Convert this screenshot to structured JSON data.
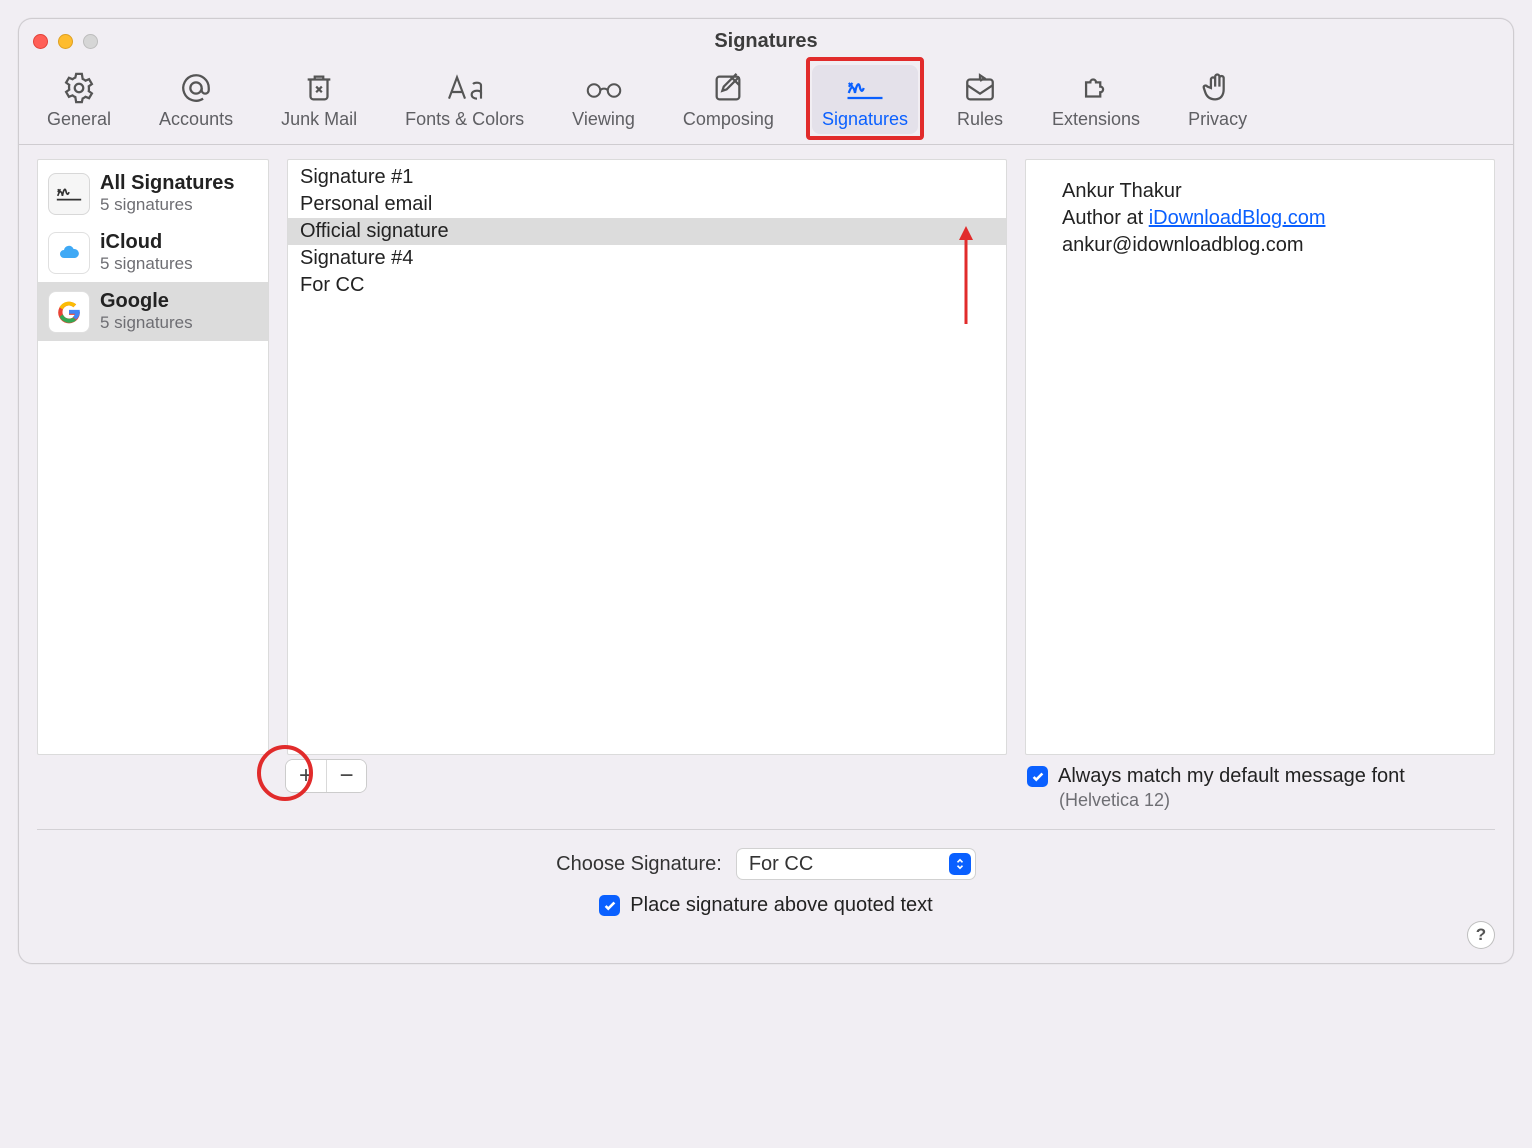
{
  "window": {
    "title": "Signatures"
  },
  "toolbar": {
    "items": [
      {
        "label": "General"
      },
      {
        "label": "Accounts"
      },
      {
        "label": "Junk Mail"
      },
      {
        "label": "Fonts & Colors"
      },
      {
        "label": "Viewing"
      },
      {
        "label": "Composing"
      },
      {
        "label": "Signatures"
      },
      {
        "label": "Rules"
      },
      {
        "label": "Extensions"
      },
      {
        "label": "Privacy"
      }
    ],
    "active_index": 6
  },
  "accounts": [
    {
      "title": "All Signatures",
      "sub": "5 signatures",
      "icon": "sign"
    },
    {
      "title": "iCloud",
      "sub": "5 signatures",
      "icon": "cloud"
    },
    {
      "title": "Google",
      "sub": "5 signatures",
      "icon": "google"
    }
  ],
  "accounts_selected_index": 2,
  "signatures": [
    "Signature #1",
    "Personal email",
    "Official signature",
    "Signature #4",
    "For CC"
  ],
  "signature_selected_index": 2,
  "preview": {
    "name": "Ankur Thakur",
    "role_prefix": "Author at ",
    "role_link": "iDownloadBlog.com",
    "email": "ankur@idownloadblog.com"
  },
  "font_option": {
    "label": "Always match my default message font",
    "note": "(Helvetica 12)",
    "checked": true
  },
  "chooser": {
    "label": "Choose Signature:",
    "value": "For CC"
  },
  "place_above": {
    "label": "Place signature above quoted text",
    "checked": true
  },
  "buttons": {
    "plus": "+",
    "minus": "−",
    "help": "?"
  }
}
